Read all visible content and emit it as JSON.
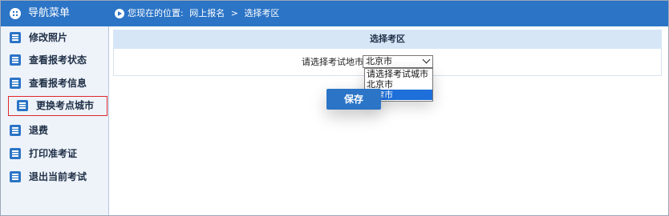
{
  "sidebar": {
    "header_label": "导航菜单",
    "items": [
      {
        "label": "修改照片"
      },
      {
        "label": "查看报考状态"
      },
      {
        "label": "查看报考信息"
      },
      {
        "label": "更换考点城市"
      },
      {
        "label": "退费"
      },
      {
        "label": "打印准考证"
      },
      {
        "label": "退出当前考试"
      }
    ]
  },
  "topbar": {
    "location_prefix": "您现在的位置:",
    "crumb_1": "网上报名",
    "separator": ">",
    "crumb_2": "选择考区"
  },
  "panel": {
    "title": "选择考区",
    "field_label": "请选择考试地市",
    "select": {
      "selected": "北京市",
      "options": [
        "请选择考试城市",
        "北京市",
        "天津市"
      ],
      "highlighted": "天津市"
    },
    "save_label": "保存"
  },
  "colors": {
    "accent": "#2b74c6",
    "sidebar_bg": "#eef3fa",
    "panel_header_bg": "#d6e6f7",
    "selected_outline": "#e0262b",
    "option_highlight": "#1e6fd9"
  },
  "icons": {
    "header": "grid-icon",
    "nav_item": "list-icon",
    "location": "play-circle-icon",
    "select": "chevron-down-icon"
  }
}
